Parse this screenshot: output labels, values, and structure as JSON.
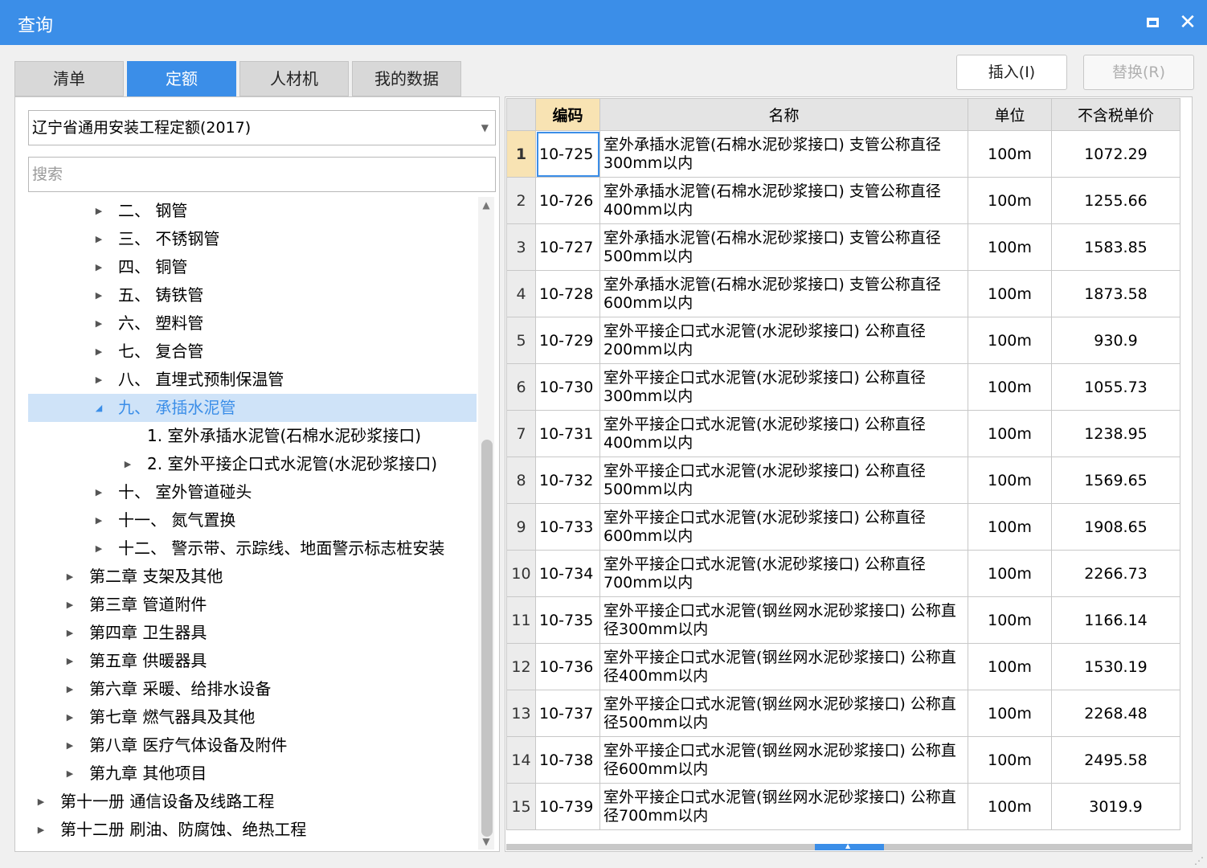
{
  "window": {
    "title": "查询"
  },
  "tabs": [
    {
      "label": "清单",
      "active": false
    },
    {
      "label": "定额",
      "active": true
    },
    {
      "label": "人材机",
      "active": false
    },
    {
      "label": "我的数据",
      "active": false
    }
  ],
  "toolbar": {
    "insert_label": "插入(I)",
    "replace_label": "替换(R)"
  },
  "library": {
    "selected": "辽宁省通用安装工程定额(2017)"
  },
  "search": {
    "placeholder": "搜索"
  },
  "tree": [
    {
      "label": "二、 钢管",
      "state": "collapsed",
      "level": 3
    },
    {
      "label": "三、 不锈钢管",
      "state": "collapsed",
      "level": 3
    },
    {
      "label": "四、 铜管",
      "state": "collapsed",
      "level": 3
    },
    {
      "label": "五、 铸铁管",
      "state": "collapsed",
      "level": 3
    },
    {
      "label": "六、 塑料管",
      "state": "collapsed",
      "level": 3
    },
    {
      "label": "七、 复合管",
      "state": "collapsed",
      "level": 3
    },
    {
      "label": "八、 直埋式预制保温管",
      "state": "collapsed",
      "level": 3
    },
    {
      "label": "九、 承插水泥管",
      "state": "expanded",
      "level": 3,
      "selected": true
    },
    {
      "label": "1. 室外承插水泥管(石棉水泥砂浆接口)",
      "state": "leaf",
      "level": 4
    },
    {
      "label": "2. 室外平接企口式水泥管(水泥砂浆接口)",
      "state": "collapsed",
      "level": 4
    },
    {
      "label": "十、 室外管道碰头",
      "state": "collapsed",
      "level": 3
    },
    {
      "label": "十一、 氮气置换",
      "state": "collapsed",
      "level": 3
    },
    {
      "label": "十二、 警示带、示踪线、地面警示标志桩安装",
      "state": "collapsed",
      "level": 3
    },
    {
      "label": "第二章 支架及其他",
      "state": "collapsed",
      "level": 2
    },
    {
      "label": "第三章 管道附件",
      "state": "collapsed",
      "level": 2
    },
    {
      "label": "第四章 卫生器具",
      "state": "collapsed",
      "level": 2
    },
    {
      "label": "第五章 供暖器具",
      "state": "collapsed",
      "level": 2
    },
    {
      "label": "第六章 采暖、给排水设备",
      "state": "collapsed",
      "level": 2
    },
    {
      "label": "第七章 燃气器具及其他",
      "state": "collapsed",
      "level": 2
    },
    {
      "label": "第八章 医疗气体设备及附件",
      "state": "collapsed",
      "level": 2
    },
    {
      "label": "第九章 其他项目",
      "state": "collapsed",
      "level": 2
    },
    {
      "label": "第十一册 通信设备及线路工程",
      "state": "collapsed",
      "level": 1
    },
    {
      "label": "第十二册 刷油、防腐蚀、绝热工程",
      "state": "collapsed",
      "level": 1
    }
  ],
  "grid": {
    "columns": [
      "编码",
      "名称",
      "单位",
      "不含税单价"
    ],
    "rows": [
      {
        "index": "1",
        "code": "10-725",
        "name": "室外承插水泥管(石棉水泥砂浆接口) 支管公称直径300mm以内",
        "unit": "100m",
        "price": "1072.29"
      },
      {
        "index": "2",
        "code": "10-726",
        "name": "室外承插水泥管(石棉水泥砂浆接口) 支管公称直径400mm以内",
        "unit": "100m",
        "price": "1255.66"
      },
      {
        "index": "3",
        "code": "10-727",
        "name": "室外承插水泥管(石棉水泥砂浆接口) 支管公称直径500mm以内",
        "unit": "100m",
        "price": "1583.85"
      },
      {
        "index": "4",
        "code": "10-728",
        "name": "室外承插水泥管(石棉水泥砂浆接口) 支管公称直径600mm以内",
        "unit": "100m",
        "price": "1873.58"
      },
      {
        "index": "5",
        "code": "10-729",
        "name": "室外平接企口式水泥管(水泥砂浆接口) 公称直径200mm以内",
        "unit": "100m",
        "price": "930.9"
      },
      {
        "index": "6",
        "code": "10-730",
        "name": "室外平接企口式水泥管(水泥砂浆接口) 公称直径300mm以内",
        "unit": "100m",
        "price": "1055.73"
      },
      {
        "index": "7",
        "code": "10-731",
        "name": "室外平接企口式水泥管(水泥砂浆接口) 公称直径400mm以内",
        "unit": "100m",
        "price": "1238.95"
      },
      {
        "index": "8",
        "code": "10-732",
        "name": "室外平接企口式水泥管(水泥砂浆接口) 公称直径500mm以内",
        "unit": "100m",
        "price": "1569.65"
      },
      {
        "index": "9",
        "code": "10-733",
        "name": "室外平接企口式水泥管(水泥砂浆接口) 公称直径600mm以内",
        "unit": "100m",
        "price": "1908.65"
      },
      {
        "index": "10",
        "code": "10-734",
        "name": "室外平接企口式水泥管(水泥砂浆接口) 公称直径700mm以内",
        "unit": "100m",
        "price": "2266.73"
      },
      {
        "index": "11",
        "code": "10-735",
        "name": "室外平接企口式水泥管(钢丝网水泥砂浆接口) 公称直径300mm以内",
        "unit": "100m",
        "price": "1166.14"
      },
      {
        "index": "12",
        "code": "10-736",
        "name": "室外平接企口式水泥管(钢丝网水泥砂浆接口) 公称直径400mm以内",
        "unit": "100m",
        "price": "1530.19"
      },
      {
        "index": "13",
        "code": "10-737",
        "name": "室外平接企口式水泥管(钢丝网水泥砂浆接口) 公称直径500mm以内",
        "unit": "100m",
        "price": "2268.48"
      },
      {
        "index": "14",
        "code": "10-738",
        "name": "室外平接企口式水泥管(钢丝网水泥砂浆接口) 公称直径600mm以内",
        "unit": "100m",
        "price": "2495.58"
      },
      {
        "index": "15",
        "code": "10-739",
        "name": "室外平接企口式水泥管(钢丝网水泥砂浆接口) 公称直径700mm以内",
        "unit": "100m",
        "price": "3019.9"
      }
    ]
  },
  "colors": {
    "accent": "#3b8ee8",
    "selected_row_bg": "#cfe3f8",
    "sort_header_bg": "#f8e3b3"
  }
}
